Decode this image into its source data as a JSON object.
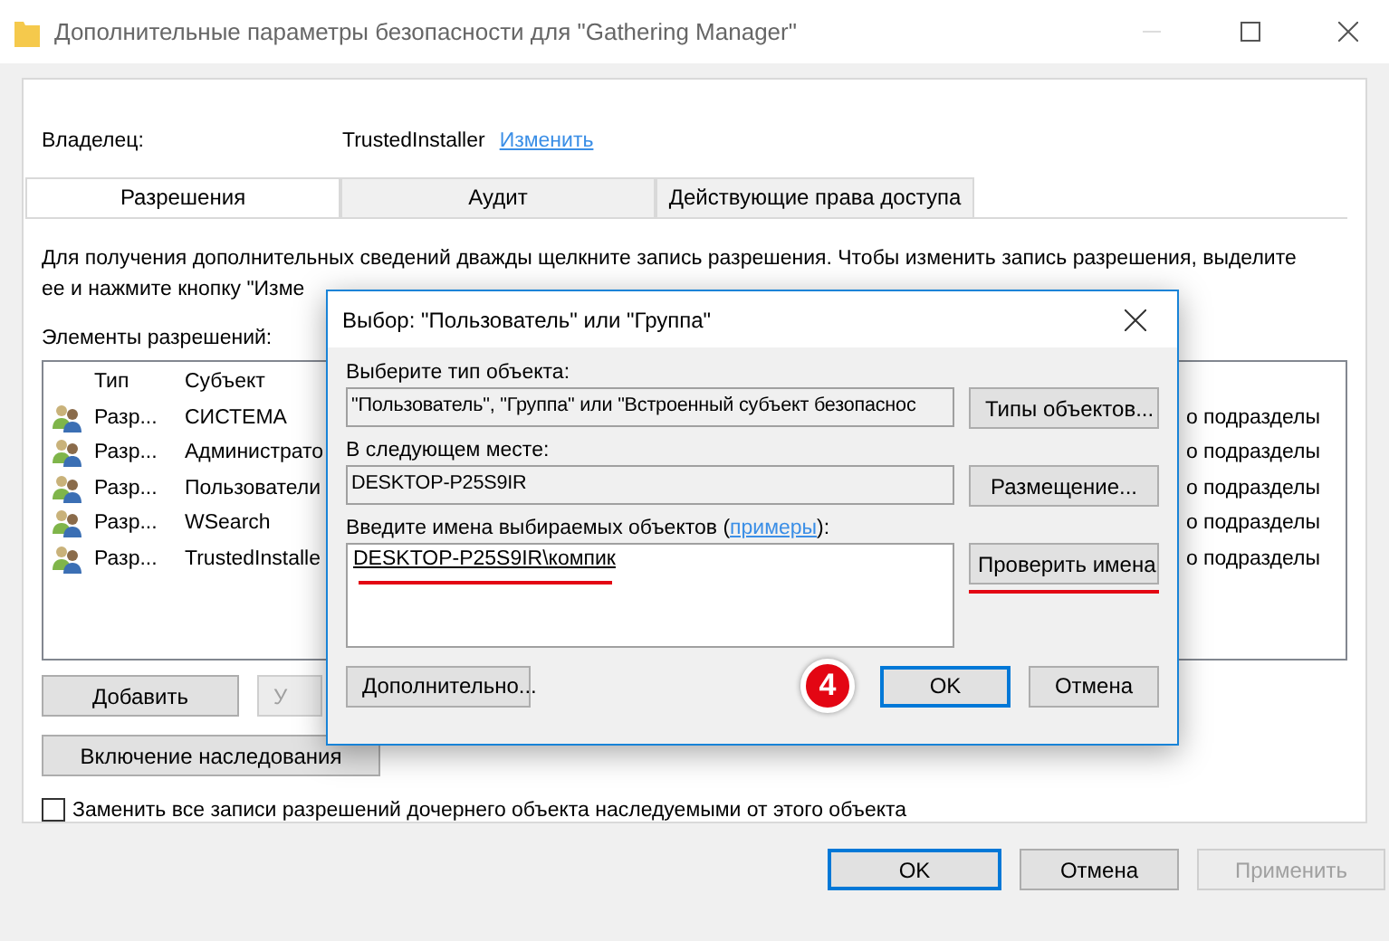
{
  "window": {
    "title": "Дополнительные параметры безопасности  для \"Gathering Manager\""
  },
  "owner": {
    "label": "Владелец:",
    "value": "TrustedInstaller",
    "link": "Изменить"
  },
  "tabs": [
    {
      "label": "Разрешения",
      "selected": true
    },
    {
      "label": "Аудит",
      "selected": false
    },
    {
      "label": "Действующие права доступа",
      "selected": false
    }
  ],
  "description": [
    "Для получения дополнительных сведений дважды щелкните запись разрешения. Чтобы изменить запись разрешения, выделите",
    "ее и нажмите кнопку \"Изме"
  ],
  "permissions": {
    "label": "Элементы разрешений:",
    "columns": [
      "Тип",
      "Субъект"
    ],
    "rows": [
      {
        "type": "Разр...",
        "subject": "СИСТЕМА",
        "column_3": "о подразделы"
      },
      {
        "type": "Разр...",
        "subject": "Администрато",
        "column_3": "о подразделы"
      },
      {
        "type": "Разр...",
        "subject": "Пользователи",
        "column_3": "о подразделы"
      },
      {
        "type": "Разр...",
        "subject": "WSearch",
        "column_3": "о подразделы"
      },
      {
        "type": "Разр...",
        "subject": "TrustedInstalle",
        "column_3": "о подразделы"
      }
    ]
  },
  "entry_buttons": [
    {
      "label": "Добавить",
      "disabled": false
    },
    {
      "label": "У",
      "disabled": true
    }
  ],
  "inherit_button": "Включение наследования",
  "replace_checkbox": {
    "label": "Заменить все записи разрешений дочернего объекта наследуемыми от этого объекта",
    "checked": false
  },
  "footer_buttons": [
    {
      "label": "OK",
      "default": true,
      "disabled": false
    },
    {
      "label": "Отмена",
      "default": false,
      "disabled": false
    },
    {
      "label": "Применить",
      "default": false,
      "disabled": true
    }
  ],
  "dialog": {
    "title": "Выбор: \"Пользователь\" или \"Группа\"",
    "object_type": {
      "label": "Выберите тип объекта:",
      "value": "\"Пользователь\", \"Группа\" или \"Встроенный субъект безопаснос",
      "button": "Типы объектов..."
    },
    "location": {
      "label": "В следующем месте:",
      "value": "DESKTOP-P25S9IR",
      "button": "Размещение..."
    },
    "names": {
      "label": "Введите имена выбираемых объектов (",
      "link": "примеры",
      "label_end": "):",
      "value": "DESKTOP-P25S9IR\\компик",
      "annotated": true
    },
    "check_button": {
      "label": "Проверить имена",
      "annotated": true
    },
    "footer_buttons": [
      {
        "label": "Дополнительно...",
        "default": false
      },
      {
        "label": "OK",
        "default": true
      },
      {
        "label": "Отмена",
        "default": false
      }
    ]
  },
  "step_badge": "4"
}
